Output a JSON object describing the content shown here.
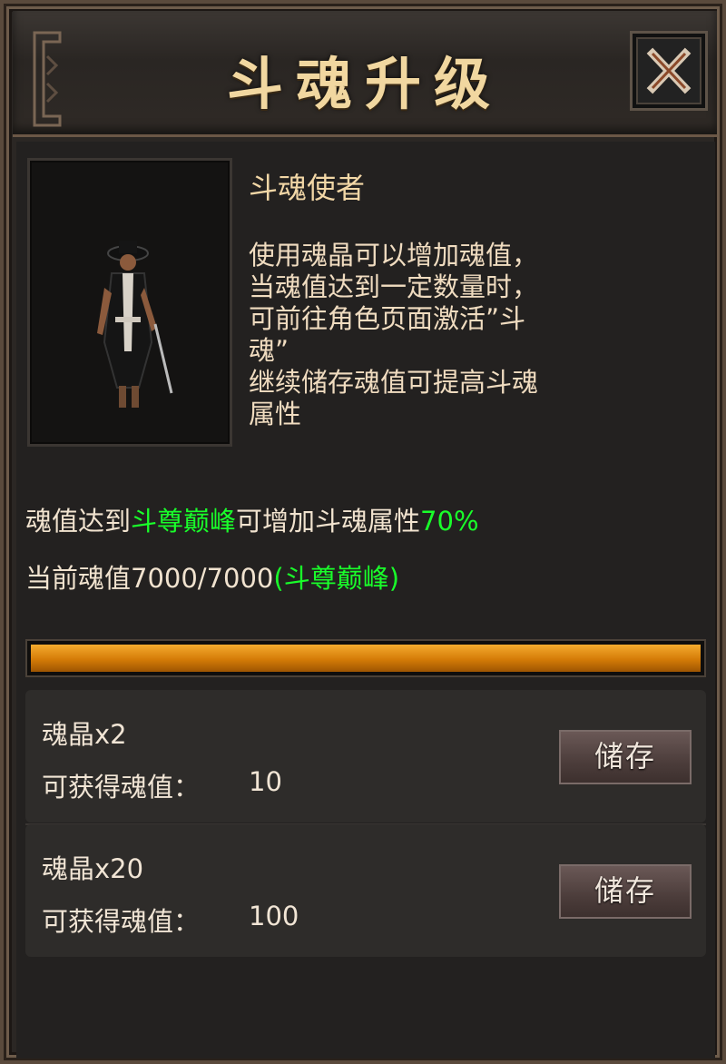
{
  "window": {
    "title": "斗魂升级",
    "close_icon": "close-icon"
  },
  "npc": {
    "name": "斗魂使者",
    "description": "使用魂晶可以增加魂值，\n当魂值达到一定数量时，\n可前往角色页面激活”斗\n魂”\n继续储存魂值可提高斗魂\n属性"
  },
  "info": {
    "line1_prefix": "魂值达到",
    "line1_rank": "斗尊巅峰",
    "line1_middle": "可增加斗魂属性",
    "line1_percent": "70%",
    "line2_prefix": "当前魂值7000/7000",
    "line2_rank": "(斗尊巅峰)"
  },
  "progress": {
    "fraction": 1.0,
    "fill_color": "#e08a10"
  },
  "items": [
    {
      "name": "魂晶x2",
      "value_label": "可获得魂值：",
      "value": "10",
      "button_label": "储存"
    },
    {
      "name": "魂晶x20",
      "value_label": "可获得魂值：",
      "value": "100",
      "button_label": "储存"
    }
  ],
  "colors": {
    "title": "#f1d7a0",
    "highlight_green": "#19ff2a",
    "progress_orange": "#e08a10"
  }
}
